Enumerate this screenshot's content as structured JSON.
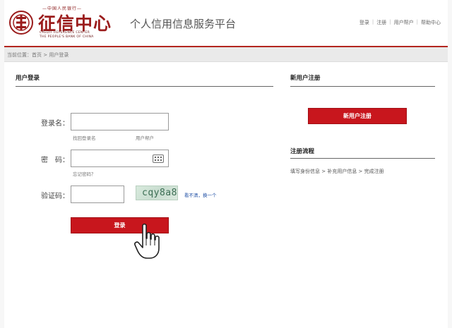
{
  "header": {
    "logo_top_text": "—中国人民银行—",
    "logo_main": "征信中心",
    "logo_en_line1": "CREDIT REFERENCE CENTER",
    "logo_en_line2": "THE PEOPLE'S BANK OF CHINA",
    "platform_title": "个人信用信息服务平台",
    "top_links": [
      "登录",
      "注册",
      "用户帮户",
      "帮助中心"
    ]
  },
  "breadcrumb": "当前位置：首页 > 用户登录",
  "login": {
    "section_title": "用户登录",
    "username_label": "登录名：",
    "username_value": "",
    "find_username_link": "找回登录名",
    "user_account_link": "用户帮户",
    "password_label": "密　码：",
    "password_value": "",
    "forgot_password_link": "忘记密码？",
    "captcha_label": "验证码：",
    "captcha_value": "",
    "captcha_image_text": "cqy8a8",
    "captcha_refresh_link": "看不清，换一个",
    "login_button": "登录"
  },
  "register": {
    "section_title": "新用户注册",
    "register_button": "新用户注册",
    "flow_title": "注册流程",
    "flow_text": "填写身份信息 > 补充用户信息 > 完成注册"
  },
  "colors": {
    "brand_red": "#c8161d",
    "logo_red": "#9b1c1c",
    "header_rule": "#b3261e"
  },
  "icons": [
    "seal-logo-icon",
    "keyboard-icon",
    "hand-pointer-icon"
  ]
}
